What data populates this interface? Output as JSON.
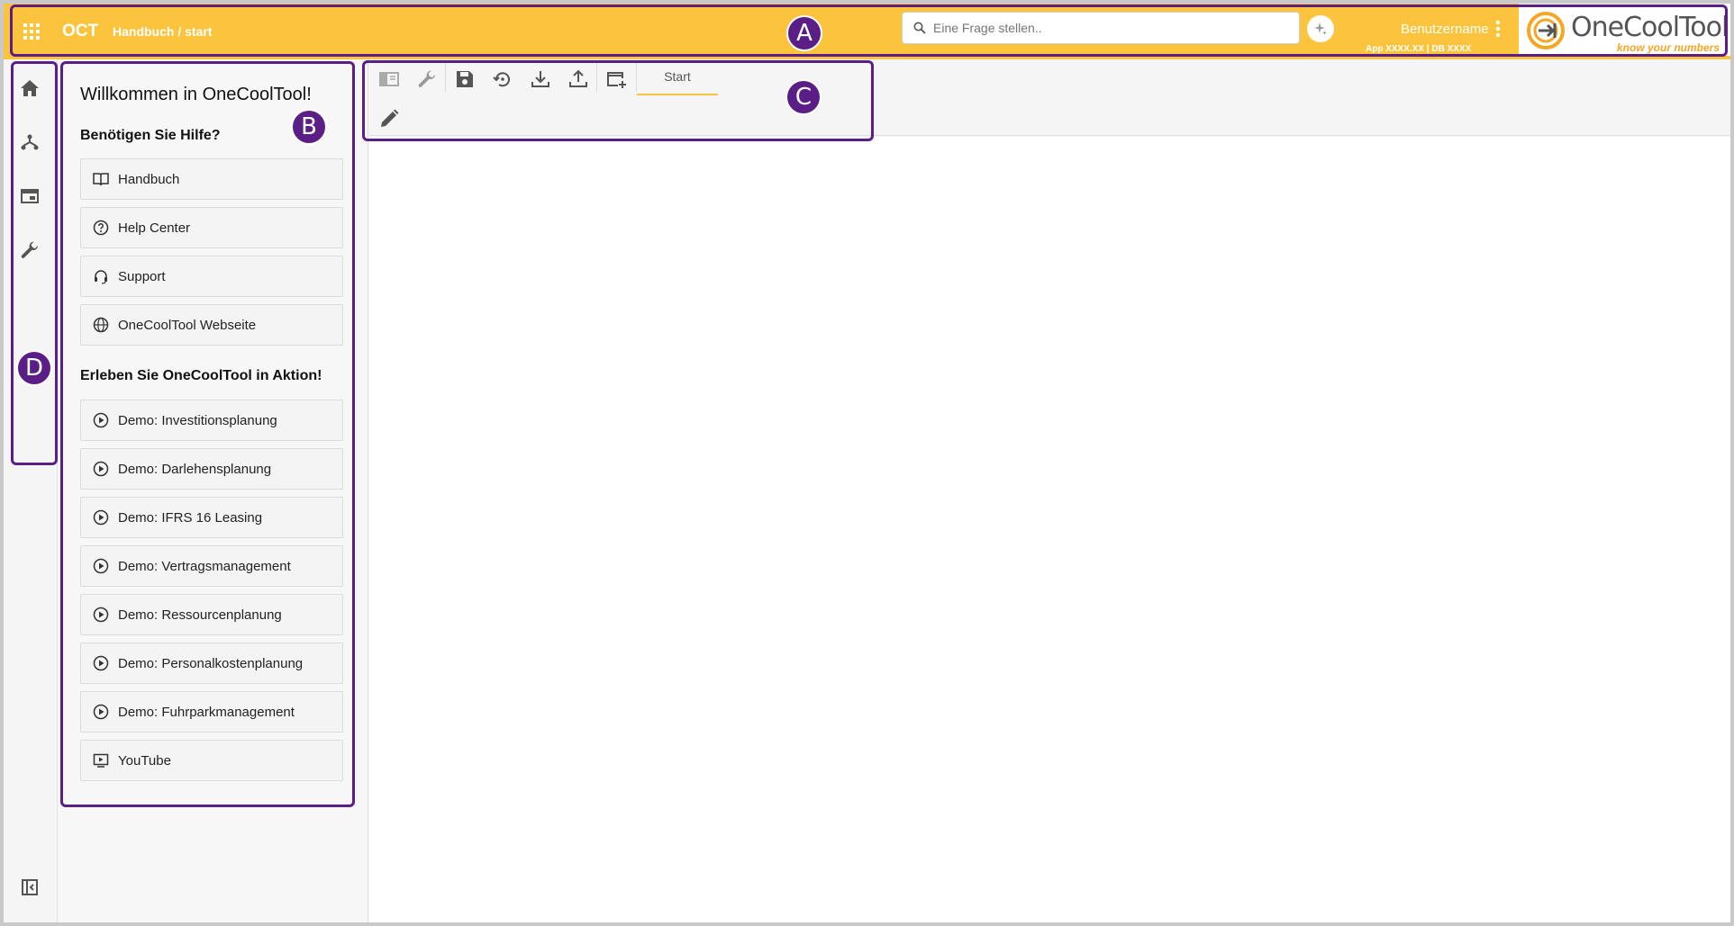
{
  "header": {
    "brand": "OCT",
    "breadcrumb": "Handbuch / start",
    "search_placeholder": "Eine Frage stellen..",
    "username": "Benutzername",
    "version": "App XXXX.XX | DB XXXX",
    "logo_text": "OneCoolTool",
    "logo_tagline": "know your numbers",
    "accent_color": "#fcc43d"
  },
  "rail": {
    "items": [
      {
        "icon": "home-icon"
      },
      {
        "icon": "hierarchy-icon"
      },
      {
        "icon": "window-icon"
      },
      {
        "icon": "wrench-icon"
      }
    ],
    "collapse_icon": "sidebar-collapse-icon"
  },
  "panel": {
    "title": "Willkommen in OneCoolTool!",
    "help_title": "Benötigen Sie Hilfe?",
    "help_items": [
      {
        "label": "Handbuch",
        "icon": "book-icon"
      },
      {
        "label": "Help Center",
        "icon": "help-circle-icon"
      },
      {
        "label": "Support",
        "icon": "headset-icon"
      },
      {
        "label": "OneCoolTool Webseite",
        "icon": "globe-icon"
      }
    ],
    "demo_title": "Erleben Sie OneCoolTool in Aktion!",
    "demo_items": [
      {
        "label": "Demo: Investitionsplanung",
        "icon": "play-circle-icon"
      },
      {
        "label": "Demo: Darlehensplanung",
        "icon": "play-circle-icon"
      },
      {
        "label": "Demo: IFRS 16 Leasing",
        "icon": "play-circle-icon"
      },
      {
        "label": "Demo: Vertragsmanagement",
        "icon": "play-circle-icon"
      },
      {
        "label": "Demo: Ressourcenplanung",
        "icon": "play-circle-icon"
      },
      {
        "label": "Demo: Personalkostenplanung",
        "icon": "play-circle-icon"
      },
      {
        "label": "Demo: Fuhrparkmanagement",
        "icon": "play-circle-icon"
      },
      {
        "label": "YouTube",
        "icon": "video-icon"
      }
    ]
  },
  "toolbar": {
    "tab_label": "Start",
    "buttons": [
      "panel-toggle-icon",
      "wrench-icon",
      "save-icon",
      "restore-icon",
      "download-icon",
      "upload-icon",
      "new-window-icon"
    ],
    "edit_icon": "pencil-icon"
  },
  "annotations": {
    "a": "A",
    "b": "B",
    "c": "C",
    "d": "D",
    "color": "#5b1e86"
  }
}
